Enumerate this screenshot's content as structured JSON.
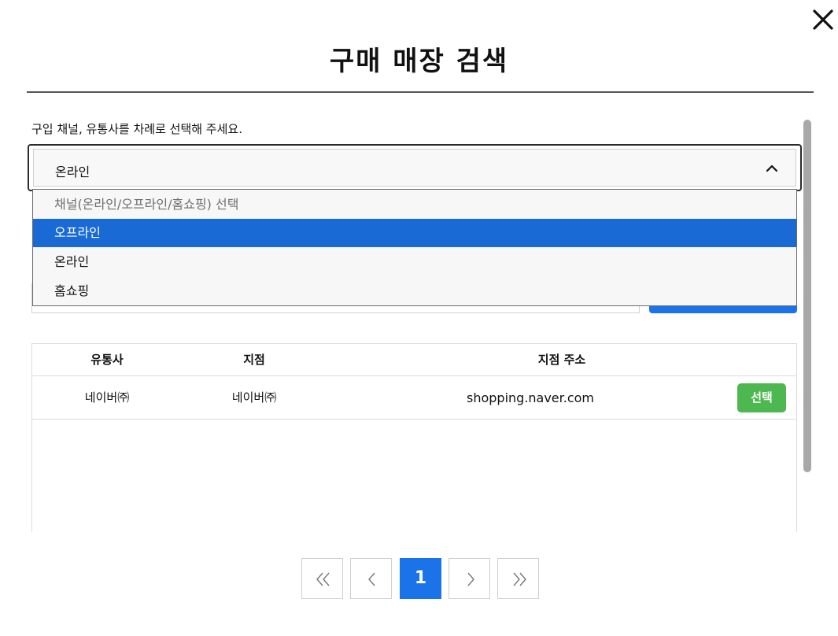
{
  "dialog": {
    "title": "구매 매장 검색",
    "close_icon": "close-icon"
  },
  "instruction": "구입 채널, 유통사를 차례로 선택해 주세요.",
  "channel_select": {
    "value": "온라인",
    "chevron_icon": "chevron-up-icon",
    "options": [
      {
        "label": "채널(온라인/오프라인/홈쇼핑) 선택",
        "placeholder": true
      },
      {
        "label": "오프라인",
        "highlighted": true
      },
      {
        "label": "온라인"
      },
      {
        "label": "홈쇼핑"
      }
    ]
  },
  "table": {
    "headers": [
      "유통사",
      "지점",
      "지점 주소"
    ],
    "rows": [
      {
        "distributor": "네이버㈜",
        "branch": "네이버㈜",
        "address": "shopping.naver.com",
        "action": "선택"
      }
    ]
  },
  "pagination": {
    "first_icon": "double-chevron-left-icon",
    "prev_icon": "chevron-left-icon",
    "current_page": "1",
    "next_icon": "chevron-right-icon",
    "last_icon": "double-chevron-right-icon"
  },
  "colors": {
    "primary": "#1a73e8",
    "dropdown_highlight": "#1a6ad6",
    "select_button": "#4cb84f",
    "scrollbar": "#a8a8a8"
  }
}
